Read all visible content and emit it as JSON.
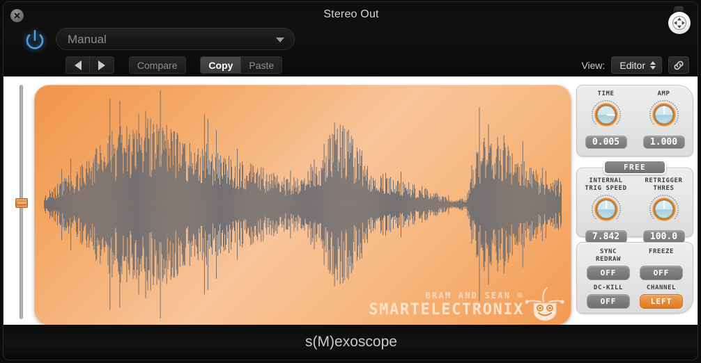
{
  "window": {
    "title": "Stereo Out",
    "close_icon": "close-icon",
    "resize_icon": "resize-move-icon",
    "power_icon": "power-icon"
  },
  "header": {
    "preset": {
      "value": "Manual",
      "placeholder": "Manual",
      "caret_icon": "chevron-down-icon"
    },
    "prev_label": "prev-preset",
    "next_label": "next-preset",
    "compare_label": "Compare",
    "copy_label": "Copy",
    "paste_label": "Paste",
    "view_label": "View:",
    "view_value": "Editor",
    "link_icon": "link-chain-icon"
  },
  "scope": {
    "zoom_slider_value": 50,
    "logo_line1": "BRAM AND SEAN ®",
    "logo_line2": "SMARTELECTRONIX",
    "robot_icon": "smartelectronix-robot-icon"
  },
  "controls": {
    "knobs": [
      {
        "name": "time",
        "label": "TIME",
        "label2": "",
        "value": "0.005",
        "angle": 92
      },
      {
        "name": "amp",
        "label": "AMP",
        "label2": "",
        "value": "1.000",
        "angle": 0
      },
      {
        "name": "internal-trig-speed",
        "label": "INTERNAL",
        "label2": "TRIG SPEED",
        "value": "7.842",
        "angle": 0
      },
      {
        "name": "retrigger-thres",
        "label": "RETRIGGER",
        "label2": "THRES",
        "value": "100.0",
        "angle": 0
      }
    ],
    "free_button": "FREE",
    "switches": [
      {
        "name": "sync-redraw",
        "label": "SYNC",
        "label2": "REDRAW",
        "value": "OFF",
        "on": false
      },
      {
        "name": "freeze",
        "label": "FREEZE",
        "label2": "",
        "value": "OFF",
        "on": false
      },
      {
        "name": "dc-kill",
        "label": "DC-KILL",
        "label2": "",
        "value": "OFF",
        "on": false
      },
      {
        "name": "channel",
        "label": "CHANNEL",
        "label2": "",
        "value": "LEFT",
        "on": true
      }
    ]
  },
  "footer": {
    "plugin_name": "s(M)exoscope"
  },
  "colors": {
    "accent_orange": "#e0791f",
    "scope_orange": "#f0944c",
    "waveform_gray": "#6e6e72",
    "knob_blue": "#b4d6e0",
    "power_blue": "#4f9fe0"
  }
}
